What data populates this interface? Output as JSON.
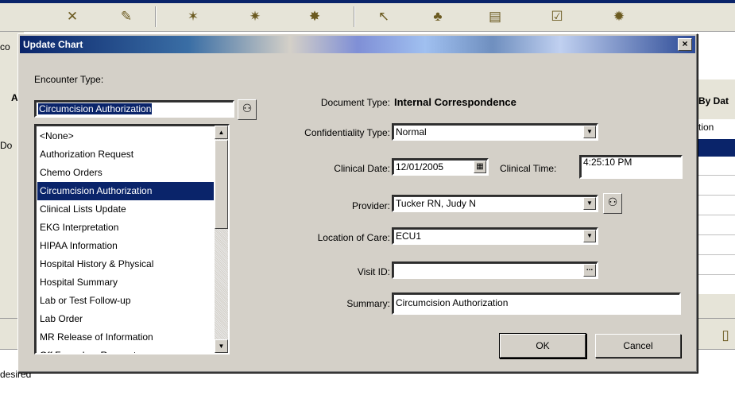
{
  "background": {
    "toolbar_icons": [
      "x-chart-icon",
      "edit-icon",
      "new-star-icon",
      "star-print-icon",
      "star-key-icon",
      "pointer-icon",
      "users-icon",
      "document-icon",
      "checklist-icon",
      "star-grid-icon"
    ],
    "left_fragments": [
      "co",
      "A",
      "Do",
      "desired"
    ],
    "right_fragments": [
      "By Dat",
      "tion"
    ]
  },
  "dialog": {
    "title": "Update Chart",
    "close_label": "×",
    "encounter_type_label": "Encounter Type:",
    "encounter_type_value": "Circumcision Authorization",
    "encounter_list": [
      "<None>",
      "Authorization Request",
      "Chemo Orders",
      "Circumcision Authorization",
      "Clinical Lists Update",
      "EKG Interpretation",
      "HIPAA Information",
      "Hospital History & Physical",
      "Hospital Summary",
      "Lab or Test Follow-up",
      "Lab Order",
      "MR Release of Information",
      "Off Formulary Request"
    ],
    "selected_index": 3,
    "document_type_label": "Document Type:",
    "document_type_value": "Internal Correspondence",
    "confidentiality_label": "Confidentiality Type:",
    "confidentiality_value": "Normal",
    "clinical_date_label": "Clinical Date:",
    "clinical_date_value": "12/01/2005",
    "clinical_time_label": "Clinical Time:",
    "clinical_time_value": "4:25:10 PM",
    "provider_label": "Provider:",
    "provider_value": "Tucker RN, Judy N",
    "location_label": "Location of Care:",
    "location_value": "ECU1",
    "visit_id_label": "Visit ID:",
    "visit_id_value": "",
    "visit_id_btn": "...",
    "summary_label": "Summary:",
    "summary_value": "Circumcision Authorization",
    "ok_label": "OK",
    "cancel_label": "Cancel"
  }
}
